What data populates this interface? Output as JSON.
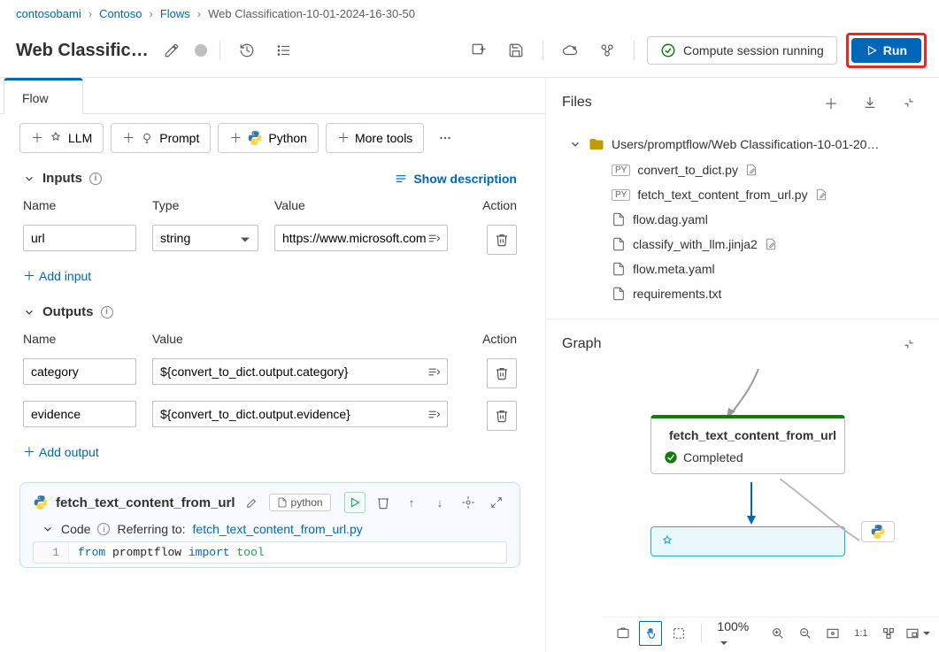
{
  "breadcrumb": {
    "a": "contosobami",
    "b": "Contoso",
    "c": "Flows",
    "d": "Web Classification-10-01-2024-16-30-50"
  },
  "header": {
    "title": "Web Classificat…",
    "compute": "Compute session running",
    "run": "Run"
  },
  "tabs": {
    "flow": "Flow"
  },
  "toolbar": {
    "llm": "LLM",
    "prompt": "Prompt",
    "python": "Python",
    "more": "More tools"
  },
  "inputs": {
    "title": "Inputs",
    "show_desc": "Show description",
    "col_name": "Name",
    "col_type": "Type",
    "col_value": "Value",
    "col_action": "Action",
    "row": {
      "name": "url",
      "type": "string",
      "value": "https://www.microsoft.com"
    },
    "add": "Add input"
  },
  "outputs": {
    "title": "Outputs",
    "col_name": "Name",
    "col_value": "Value",
    "col_action": "Action",
    "rows": [
      {
        "name": "category",
        "value": "${convert_to_dict.output.category}"
      },
      {
        "name": "evidence",
        "value": "${convert_to_dict.output.evidence}"
      }
    ],
    "add": "Add output"
  },
  "node": {
    "name": "fetch_text_content_from_url",
    "lang": "python",
    "code_label": "Code",
    "referring": "Referring to:",
    "ref_file": "fetch_text_content_from_url.py",
    "line_no": "1",
    "code_from": "from",
    "code_mod": "promptflow",
    "code_import": "import",
    "code_ident": "tool"
  },
  "files": {
    "title": "Files",
    "folder": "Users/promptflow/Web Classification-10-01-20…",
    "items": [
      {
        "kind": "py",
        "name": "convert_to_dict.py",
        "editable": true
      },
      {
        "kind": "py",
        "name": "fetch_text_content_from_url.py",
        "editable": true
      },
      {
        "kind": "file",
        "name": "flow.dag.yaml"
      },
      {
        "kind": "file",
        "name": "classify_with_llm.jinja2",
        "editable": true
      },
      {
        "kind": "file",
        "name": "flow.meta.yaml"
      },
      {
        "kind": "file",
        "name": "requirements.txt"
      }
    ]
  },
  "graph": {
    "title": "Graph",
    "node1_title": "fetch_text_content_from_url",
    "node1_status": "Completed",
    "zoom": "100%"
  }
}
